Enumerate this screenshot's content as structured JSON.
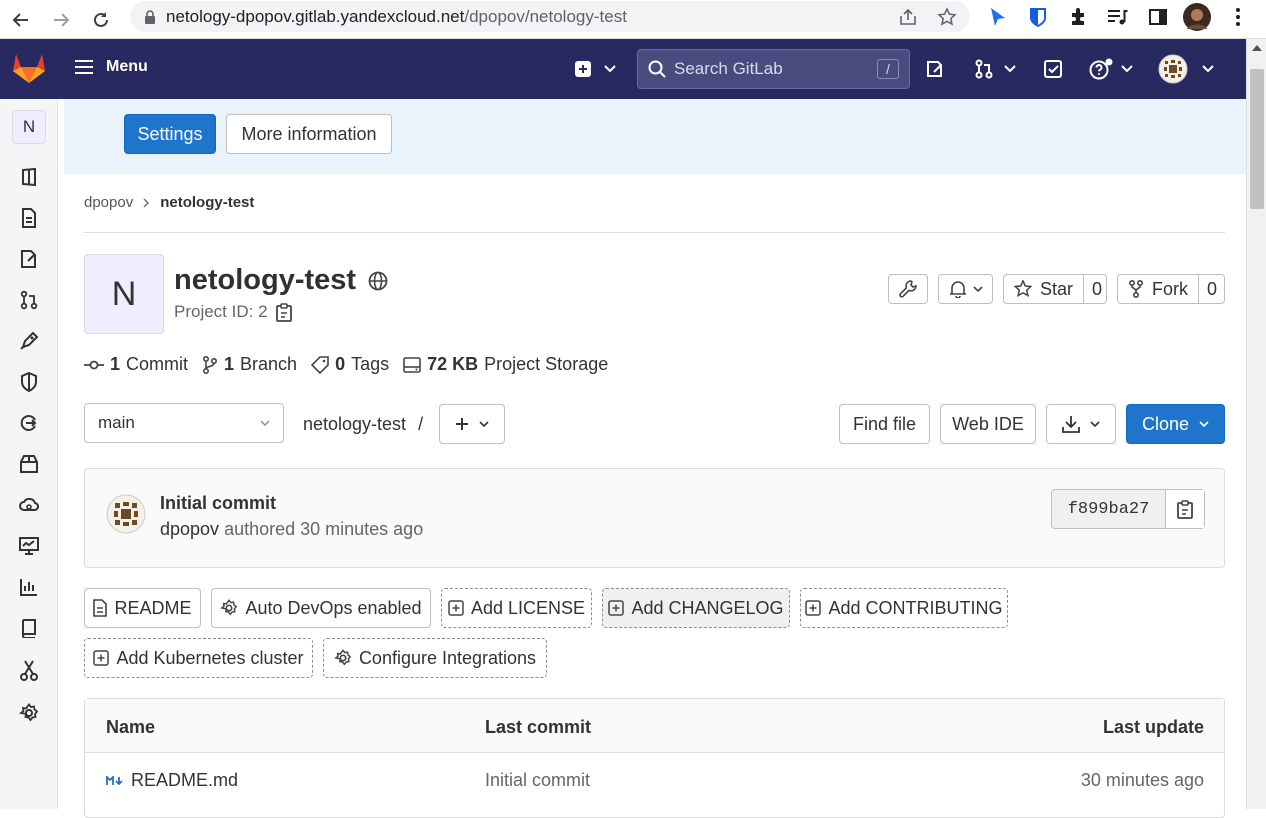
{
  "browser": {
    "url_host": "netology-dpopov.gitlab.yandexcloud.net",
    "url_path": "/dpopov/netology-test"
  },
  "header": {
    "menu_label": "Menu",
    "search_placeholder": "Search GitLab",
    "search_shortcut": "/"
  },
  "sidebar": {
    "project_initial": "N",
    "items": [
      "project-overview",
      "repository",
      "issues",
      "merge-requests",
      "ci-cd",
      "security",
      "deployments",
      "packages",
      "infrastructure",
      "monitor",
      "analytics",
      "wiki",
      "snippets",
      "settings"
    ]
  },
  "banner": {
    "settings_label": "Settings",
    "more_info_label": "More information"
  },
  "breadcrumb": {
    "parent": "dpopov",
    "current": "netology-test"
  },
  "project": {
    "initial": "N",
    "name": "netology-test",
    "id_label": "Project ID: 2",
    "star_label": "Star",
    "star_count": "0",
    "fork_label": "Fork",
    "fork_count": "0"
  },
  "stats": {
    "commits_count": "1",
    "commits_label": "Commit",
    "branches_count": "1",
    "branches_label": "Branch",
    "tags_count": "0",
    "tags_label": "Tags",
    "storage_size": "72 KB",
    "storage_label": "Project Storage"
  },
  "repo_bar": {
    "branch": "main",
    "path": "netology-test",
    "path_sep": "/",
    "find_file": "Find file",
    "web_ide": "Web IDE",
    "clone": "Clone"
  },
  "commit": {
    "title": "Initial commit",
    "author": "dpopov",
    "meta": "authored 30 minutes ago",
    "sha": "f899ba27"
  },
  "shortcuts": {
    "readme": "README",
    "auto_devops": "Auto DevOps enabled",
    "add_license": "Add LICENSE",
    "add_changelog": "Add CHANGELOG",
    "add_contributing": "Add CONTRIBUTING",
    "add_k8s": "Add Kubernetes cluster",
    "configure_integrations": "Configure Integrations"
  },
  "files_table": {
    "col_name": "Name",
    "col_last_commit": "Last commit",
    "col_last_update": "Last update",
    "rows": [
      {
        "name": "README.md",
        "last_commit": "Initial commit",
        "last_update": "30 minutes ago"
      }
    ]
  },
  "colors": {
    "header_bg": "#292961",
    "primary": "#1f75cb",
    "banner_bg": "#e9f3fc"
  }
}
